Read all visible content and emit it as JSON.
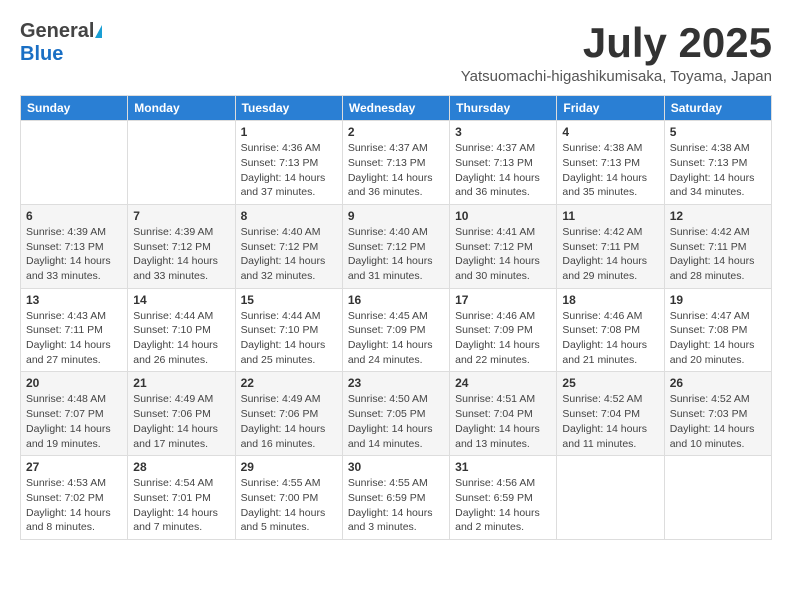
{
  "header": {
    "logo_line1_gen": "General",
    "logo_line1_blue": "Blue",
    "month": "July 2025",
    "location": "Yatsuomachi-higashikumisaka, Toyama, Japan"
  },
  "days_of_week": [
    "Sunday",
    "Monday",
    "Tuesday",
    "Wednesday",
    "Thursday",
    "Friday",
    "Saturday"
  ],
  "weeks": [
    [
      {
        "day": "",
        "info": ""
      },
      {
        "day": "",
        "info": ""
      },
      {
        "day": "1",
        "info": "Sunrise: 4:36 AM\nSunset: 7:13 PM\nDaylight: 14 hours and 37 minutes."
      },
      {
        "day": "2",
        "info": "Sunrise: 4:37 AM\nSunset: 7:13 PM\nDaylight: 14 hours and 36 minutes."
      },
      {
        "day": "3",
        "info": "Sunrise: 4:37 AM\nSunset: 7:13 PM\nDaylight: 14 hours and 36 minutes."
      },
      {
        "day": "4",
        "info": "Sunrise: 4:38 AM\nSunset: 7:13 PM\nDaylight: 14 hours and 35 minutes."
      },
      {
        "day": "5",
        "info": "Sunrise: 4:38 AM\nSunset: 7:13 PM\nDaylight: 14 hours and 34 minutes."
      }
    ],
    [
      {
        "day": "6",
        "info": "Sunrise: 4:39 AM\nSunset: 7:13 PM\nDaylight: 14 hours and 33 minutes."
      },
      {
        "day": "7",
        "info": "Sunrise: 4:39 AM\nSunset: 7:12 PM\nDaylight: 14 hours and 33 minutes."
      },
      {
        "day": "8",
        "info": "Sunrise: 4:40 AM\nSunset: 7:12 PM\nDaylight: 14 hours and 32 minutes."
      },
      {
        "day": "9",
        "info": "Sunrise: 4:40 AM\nSunset: 7:12 PM\nDaylight: 14 hours and 31 minutes."
      },
      {
        "day": "10",
        "info": "Sunrise: 4:41 AM\nSunset: 7:12 PM\nDaylight: 14 hours and 30 minutes."
      },
      {
        "day": "11",
        "info": "Sunrise: 4:42 AM\nSunset: 7:11 PM\nDaylight: 14 hours and 29 minutes."
      },
      {
        "day": "12",
        "info": "Sunrise: 4:42 AM\nSunset: 7:11 PM\nDaylight: 14 hours and 28 minutes."
      }
    ],
    [
      {
        "day": "13",
        "info": "Sunrise: 4:43 AM\nSunset: 7:11 PM\nDaylight: 14 hours and 27 minutes."
      },
      {
        "day": "14",
        "info": "Sunrise: 4:44 AM\nSunset: 7:10 PM\nDaylight: 14 hours and 26 minutes."
      },
      {
        "day": "15",
        "info": "Sunrise: 4:44 AM\nSunset: 7:10 PM\nDaylight: 14 hours and 25 minutes."
      },
      {
        "day": "16",
        "info": "Sunrise: 4:45 AM\nSunset: 7:09 PM\nDaylight: 14 hours and 24 minutes."
      },
      {
        "day": "17",
        "info": "Sunrise: 4:46 AM\nSunset: 7:09 PM\nDaylight: 14 hours and 22 minutes."
      },
      {
        "day": "18",
        "info": "Sunrise: 4:46 AM\nSunset: 7:08 PM\nDaylight: 14 hours and 21 minutes."
      },
      {
        "day": "19",
        "info": "Sunrise: 4:47 AM\nSunset: 7:08 PM\nDaylight: 14 hours and 20 minutes."
      }
    ],
    [
      {
        "day": "20",
        "info": "Sunrise: 4:48 AM\nSunset: 7:07 PM\nDaylight: 14 hours and 19 minutes."
      },
      {
        "day": "21",
        "info": "Sunrise: 4:49 AM\nSunset: 7:06 PM\nDaylight: 14 hours and 17 minutes."
      },
      {
        "day": "22",
        "info": "Sunrise: 4:49 AM\nSunset: 7:06 PM\nDaylight: 14 hours and 16 minutes."
      },
      {
        "day": "23",
        "info": "Sunrise: 4:50 AM\nSunset: 7:05 PM\nDaylight: 14 hours and 14 minutes."
      },
      {
        "day": "24",
        "info": "Sunrise: 4:51 AM\nSunset: 7:04 PM\nDaylight: 14 hours and 13 minutes."
      },
      {
        "day": "25",
        "info": "Sunrise: 4:52 AM\nSunset: 7:04 PM\nDaylight: 14 hours and 11 minutes."
      },
      {
        "day": "26",
        "info": "Sunrise: 4:52 AM\nSunset: 7:03 PM\nDaylight: 14 hours and 10 minutes."
      }
    ],
    [
      {
        "day": "27",
        "info": "Sunrise: 4:53 AM\nSunset: 7:02 PM\nDaylight: 14 hours and 8 minutes."
      },
      {
        "day": "28",
        "info": "Sunrise: 4:54 AM\nSunset: 7:01 PM\nDaylight: 14 hours and 7 minutes."
      },
      {
        "day": "29",
        "info": "Sunrise: 4:55 AM\nSunset: 7:00 PM\nDaylight: 14 hours and 5 minutes."
      },
      {
        "day": "30",
        "info": "Sunrise: 4:55 AM\nSunset: 6:59 PM\nDaylight: 14 hours and 3 minutes."
      },
      {
        "day": "31",
        "info": "Sunrise: 4:56 AM\nSunset: 6:59 PM\nDaylight: 14 hours and 2 minutes."
      },
      {
        "day": "",
        "info": ""
      },
      {
        "day": "",
        "info": ""
      }
    ]
  ]
}
